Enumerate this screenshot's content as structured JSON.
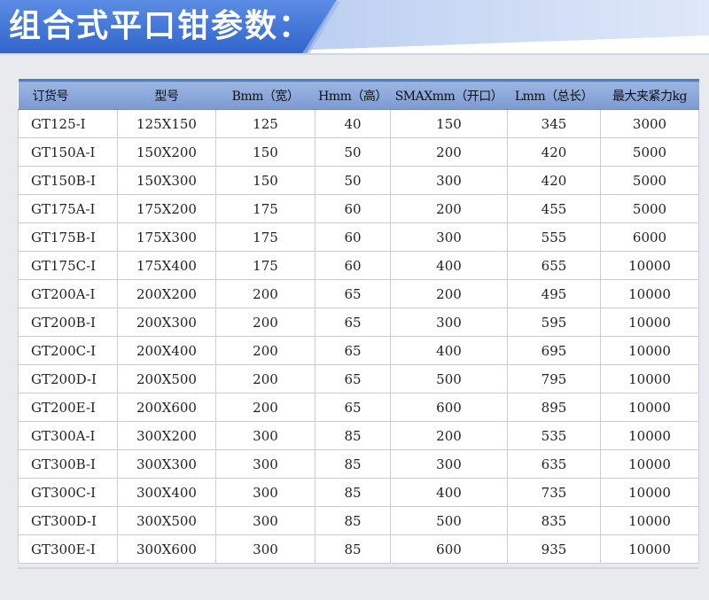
{
  "header": {
    "title": "组合式平口钳参数："
  },
  "colors": {
    "banner_blue": "#3f74d6",
    "header_blue": "#8aa6da",
    "border": "#c9ccd4"
  },
  "table": {
    "columns": [
      "订货号",
      "型号",
      "Bmm（宽）",
      "Hmm（高）",
      "SMAXmm（开口）",
      "Lmm（总长）",
      "最大夹紧力kg"
    ],
    "rows": [
      [
        "GT125-I",
        "125X150",
        "125",
        "40",
        "150",
        "345",
        "3000"
      ],
      [
        "GT150A-I",
        "150X200",
        "150",
        "50",
        "200",
        "420",
        "5000"
      ],
      [
        "GT150B-I",
        "150X300",
        "150",
        "50",
        "300",
        "420",
        "5000"
      ],
      [
        "GT175A-I",
        "175X200",
        "175",
        "60",
        "200",
        "455",
        "5000"
      ],
      [
        "GT175B-I",
        "175X300",
        "175",
        "60",
        "300",
        "555",
        "6000"
      ],
      [
        "GT175C-I",
        "175X400",
        "175",
        "60",
        "400",
        "655",
        "10000"
      ],
      [
        "GT200A-I",
        "200X200",
        "200",
        "65",
        "200",
        "495",
        "10000"
      ],
      [
        "GT200B-I",
        "200X300",
        "200",
        "65",
        "300",
        "595",
        "10000"
      ],
      [
        "GT200C-I",
        "200X400",
        "200",
        "65",
        "400",
        "695",
        "10000"
      ],
      [
        "GT200D-I",
        "200X500",
        "200",
        "65",
        "500",
        "795",
        "10000"
      ],
      [
        "GT200E-I",
        "200X600",
        "200",
        "65",
        "600",
        "895",
        "10000"
      ],
      [
        "GT300A-I",
        "300X200",
        "300",
        "85",
        "200",
        "535",
        "10000"
      ],
      [
        "GT300B-I",
        "300X300",
        "300",
        "85",
        "300",
        "635",
        "10000"
      ],
      [
        "GT300C-I",
        "300X400",
        "300",
        "85",
        "400",
        "735",
        "10000"
      ],
      [
        "GT300D-I",
        "300X500",
        "300",
        "85",
        "500",
        "835",
        "10000"
      ],
      [
        "GT300E-I",
        "300X600",
        "300",
        "85",
        "600",
        "935",
        "10000"
      ]
    ]
  }
}
